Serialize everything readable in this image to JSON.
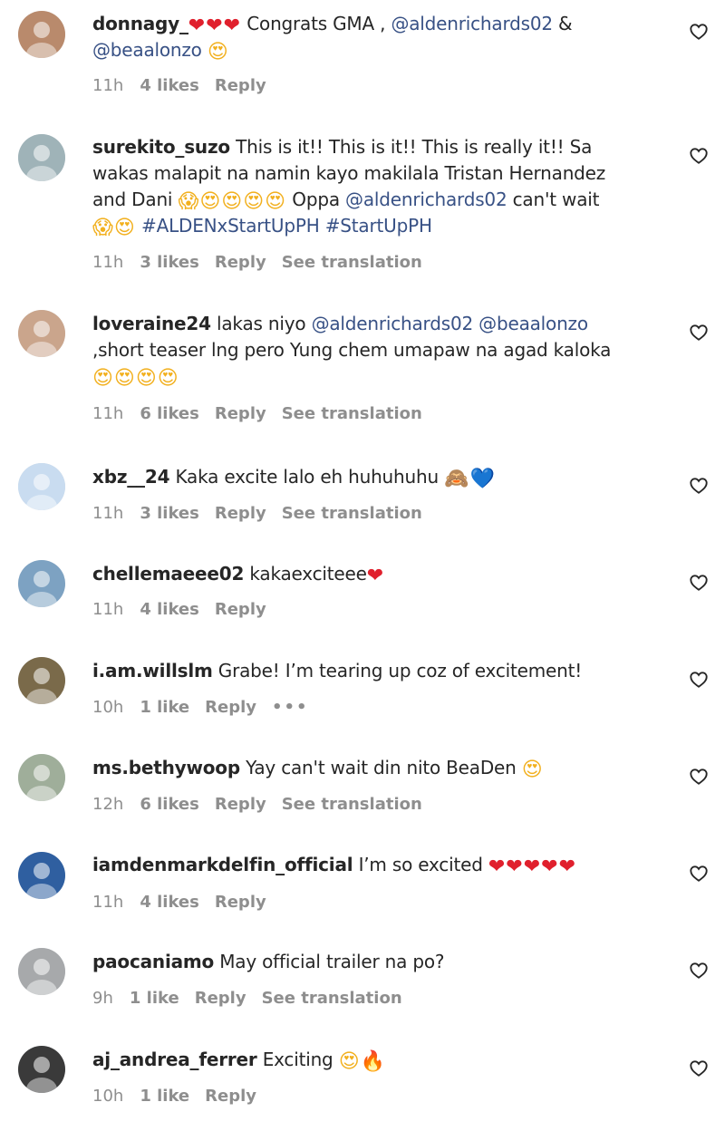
{
  "comments": [
    {
      "username": "donnagy_",
      "parts": [
        {
          "t": "emoji",
          "v": "❤❤❤",
          "c": "red"
        },
        {
          "t": "text",
          "v": " Congrats GMA , "
        },
        {
          "t": "mention",
          "v": "@aldenrichards02"
        },
        {
          "t": "text",
          "v": " & "
        },
        {
          "t": "mention",
          "v": "@beaalonzo"
        },
        {
          "t": "text",
          "v": " "
        },
        {
          "t": "emoji",
          "v": "😍",
          "c": "yel"
        }
      ],
      "time": "11h",
      "likes": "4 likes",
      "reply": "Reply",
      "translation": "",
      "avatar_color": "#b98a6c"
    },
    {
      "username": "surekito_suzo",
      "parts": [
        {
          "t": "text",
          "v": " This is it!! This is it!! This is really it!! Sa wakas malapit na namin kayo makilala Tristan Hernandez and Dani "
        },
        {
          "t": "emoji",
          "v": "😱😍😍😍😍",
          "c": "yel"
        },
        {
          "t": "text",
          "v": " Oppa "
        },
        {
          "t": "mention",
          "v": "@aldenrichards02"
        },
        {
          "t": "text",
          "v": " can't wait "
        },
        {
          "t": "emoji",
          "v": "😱😍",
          "c": "yel"
        },
        {
          "t": "text",
          "v": " "
        },
        {
          "t": "hashtag",
          "v": "#ALDENxStartUpPH"
        },
        {
          "t": "text",
          "v": " "
        },
        {
          "t": "hashtag",
          "v": "#StartUpPH"
        }
      ],
      "time": "11h",
      "likes": "3 likes",
      "reply": "Reply",
      "translation": "See translation",
      "avatar_color": "#9fb3b8"
    },
    {
      "username": "loveraine24",
      "parts": [
        {
          "t": "text",
          "v": " lakas niyo "
        },
        {
          "t": "mention",
          "v": "@aldenrichards02"
        },
        {
          "t": "text",
          "v": " "
        },
        {
          "t": "mention",
          "v": "@beaalonzo"
        },
        {
          "t": "text",
          "v": " ,short teaser lng pero Yung chem umapaw na agad kaloka "
        },
        {
          "t": "emoji",
          "v": "😍😍😍😍",
          "c": "yel"
        }
      ],
      "time": "11h",
      "likes": "6 likes",
      "reply": "Reply",
      "translation": "See translation",
      "avatar_color": "#caa58c"
    },
    {
      "username": "xbz__24",
      "parts": [
        {
          "t": "text",
          "v": " Kaka excite lalo eh huhuhuhu "
        },
        {
          "t": "emoji",
          "v": "🙈",
          "c": "org"
        },
        {
          "t": "emoji",
          "v": "💙",
          "c": "blu"
        }
      ],
      "time": "11h",
      "likes": "3 likes",
      "reply": "Reply",
      "translation": "See translation",
      "avatar_color": "#c9dcf0"
    },
    {
      "username": "chellemaeee02",
      "parts": [
        {
          "t": "text",
          "v": " kakaexciteee"
        },
        {
          "t": "emoji",
          "v": "❤",
          "c": "red"
        }
      ],
      "time": "11h",
      "likes": "4 likes",
      "reply": "Reply",
      "translation": "",
      "avatar_color": "#7da2c2"
    },
    {
      "username": "i.am.willslm",
      "parts": [
        {
          "t": "text",
          "v": " Grabe! I’m tearing up coz of excitement!"
        }
      ],
      "time": "10h",
      "likes": "1 like",
      "reply": "Reply",
      "translation": "",
      "more": "•••",
      "avatar_color": "#7a6a4a"
    },
    {
      "username": "ms.bethywoop",
      "parts": [
        {
          "t": "text",
          "v": " Yay can't wait din nito BeaDen "
        },
        {
          "t": "emoji",
          "v": "😍",
          "c": "yel"
        }
      ],
      "time": "12h",
      "likes": "6 likes",
      "reply": "Reply",
      "translation": "See translation",
      "avatar_color": "#9fae9a"
    },
    {
      "username": "iamdenmarkdelfin_official",
      "parts": [
        {
          "t": "text",
          "v": " I’m so excited "
        },
        {
          "t": "emoji",
          "v": "❤❤❤❤❤",
          "c": "red"
        }
      ],
      "time": "11h",
      "likes": "4 likes",
      "reply": "Reply",
      "translation": "",
      "avatar_color": "#2f5fa0"
    },
    {
      "username": "paocaniamo",
      "parts": [
        {
          "t": "text",
          "v": " May official trailer na po?"
        }
      ],
      "time": "9h",
      "likes": "1 like",
      "reply": "Reply",
      "translation": "See translation",
      "avatar_color": "#a7a9ab"
    },
    {
      "username": "aj_andrea_ferrer",
      "parts": [
        {
          "t": "text",
          "v": " Exciting "
        },
        {
          "t": "emoji",
          "v": "😍",
          "c": "yel"
        },
        {
          "t": "emoji",
          "v": "🔥",
          "c": "org"
        }
      ],
      "time": "10h",
      "likes": "1 like",
      "reply": "Reply",
      "translation": "",
      "avatar_color": "#3a3a3a"
    }
  ]
}
